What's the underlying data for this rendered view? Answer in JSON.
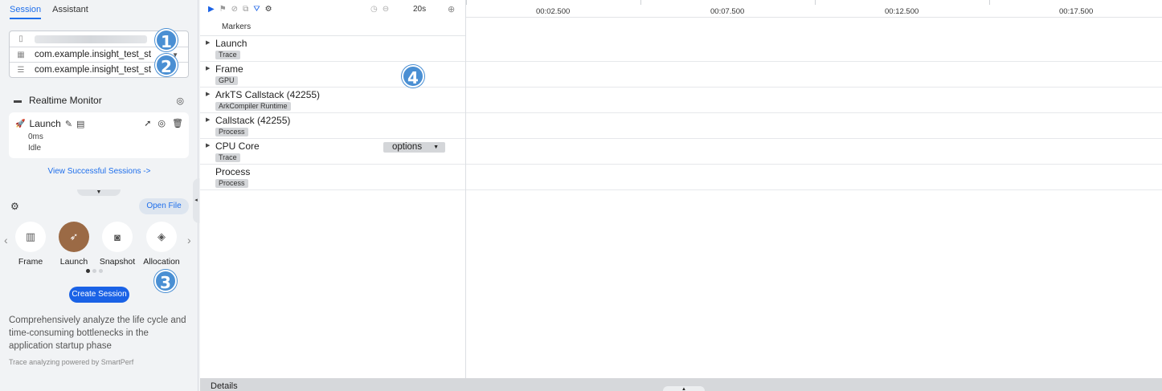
{
  "tabs": [
    {
      "label": "Session",
      "active": true
    },
    {
      "label": "Assistant",
      "active": false
    }
  ],
  "device": {
    "app1": "com.example.insight_test_st",
    "app2": "com.example.insight_test_st"
  },
  "badges": [
    "1",
    "2",
    "3",
    "4"
  ],
  "realtime": {
    "label": "Realtime Monitor"
  },
  "session_card": {
    "title": "Launch",
    "duration": "0ms",
    "status": "Idle"
  },
  "view_successful": "View Successful Sessions ->",
  "open_file": "Open File",
  "templates": [
    {
      "label": "Frame",
      "icon": "frame-icon",
      "selected": false
    },
    {
      "label": "Launch",
      "icon": "rocket-icon",
      "selected": true
    },
    {
      "label": "Snapshot",
      "icon": "camera-icon",
      "selected": false
    },
    {
      "label": "Allocation",
      "icon": "box-icon",
      "selected": false
    }
  ],
  "create_session": "Create Session",
  "description": "Comprehensively analyze the life cycle and time-consuming bottlenecks in the application startup phase",
  "powered_by": "Trace analyzing powered by SmartPerf",
  "toolbar": {
    "span": "20s"
  },
  "ruler": [
    "00:02.500",
    "00:07.500",
    "00:12.500",
    "00:17.500"
  ],
  "markers": "Markers",
  "lanes": [
    {
      "name": "Launch",
      "tag": "Trace",
      "expandable": true
    },
    {
      "name": "Frame",
      "tag": "GPU",
      "expandable": true
    },
    {
      "name": "ArkTS Callstack (42255)",
      "tag": "ArkCompiler Runtime",
      "expandable": true
    },
    {
      "name": "Callstack (42255)",
      "tag": "Process",
      "expandable": true
    },
    {
      "name": "CPU Core",
      "tag": "Trace",
      "expandable": true,
      "options": "options"
    },
    {
      "name": "Process",
      "tag": "Process",
      "expandable": false
    }
  ],
  "details": "Details",
  "colors": {
    "accent": "#1a62e6",
    "badge": "#4a8fd3",
    "selected_template": "#9b6a45"
  }
}
